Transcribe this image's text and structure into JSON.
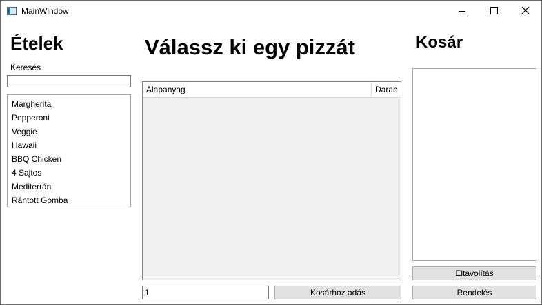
{
  "window": {
    "title": "MainWindow",
    "icons": {
      "app": "app-window-icon",
      "minimize": "minimize-icon",
      "maximize": "maximize-icon",
      "close": "close-icon"
    }
  },
  "left": {
    "heading": "Ételek",
    "search_label": "Keresés",
    "search_value": "",
    "foods": [
      "Margherita",
      "Pepperoni",
      "Veggie",
      "Hawaii",
      "BBQ Chicken",
      "4 Sajtos",
      "Mediterrán",
      "Rántott Gomba"
    ]
  },
  "center": {
    "heading": "Válassz ki egy pizzát",
    "columns": [
      "Alapanyag",
      "Darab"
    ],
    "rows": [],
    "quantity_value": "1",
    "add_button": "Kosárhoz adás"
  },
  "right": {
    "heading": "Kosár",
    "cart_items": [],
    "remove_button": "Eltávolítás",
    "order_button": "Rendelés"
  }
}
